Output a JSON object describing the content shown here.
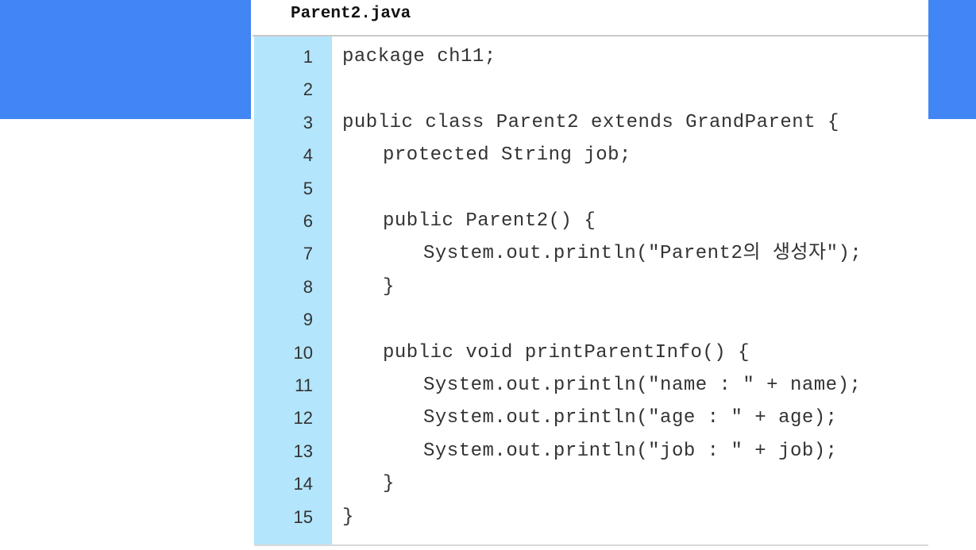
{
  "colors": {
    "band": "#4285f4",
    "gutter": "#b3e5fc"
  },
  "file_name": "Parent2.java",
  "lines": [
    {
      "n": "1",
      "indent": 0,
      "code": "package ch11;"
    },
    {
      "n": "2",
      "indent": 0,
      "code": ""
    },
    {
      "n": "3",
      "indent": 0,
      "code": "public class Parent2 extends GrandParent {"
    },
    {
      "n": "4",
      "indent": 1,
      "code": "protected String job;"
    },
    {
      "n": "5",
      "indent": 0,
      "code": ""
    },
    {
      "n": "6",
      "indent": 1,
      "code": "public Parent2() {"
    },
    {
      "n": "7",
      "indent": 2,
      "code": "System.out.println(\"Parent2의 생성자\");"
    },
    {
      "n": "8",
      "indent": 1,
      "code": "}"
    },
    {
      "n": "9",
      "indent": 0,
      "code": ""
    },
    {
      "n": "10",
      "indent": 1,
      "code": "public void printParentInfo() {"
    },
    {
      "n": "11",
      "indent": 2,
      "code": "System.out.println(\"name : \" + name);"
    },
    {
      "n": "12",
      "indent": 2,
      "code": "System.out.println(\"age : \" + age);"
    },
    {
      "n": "13",
      "indent": 2,
      "code": "System.out.println(\"job : \" + job);"
    },
    {
      "n": "14",
      "indent": 1,
      "code": "}"
    },
    {
      "n": "15",
      "indent": 0,
      "code": "}"
    }
  ]
}
